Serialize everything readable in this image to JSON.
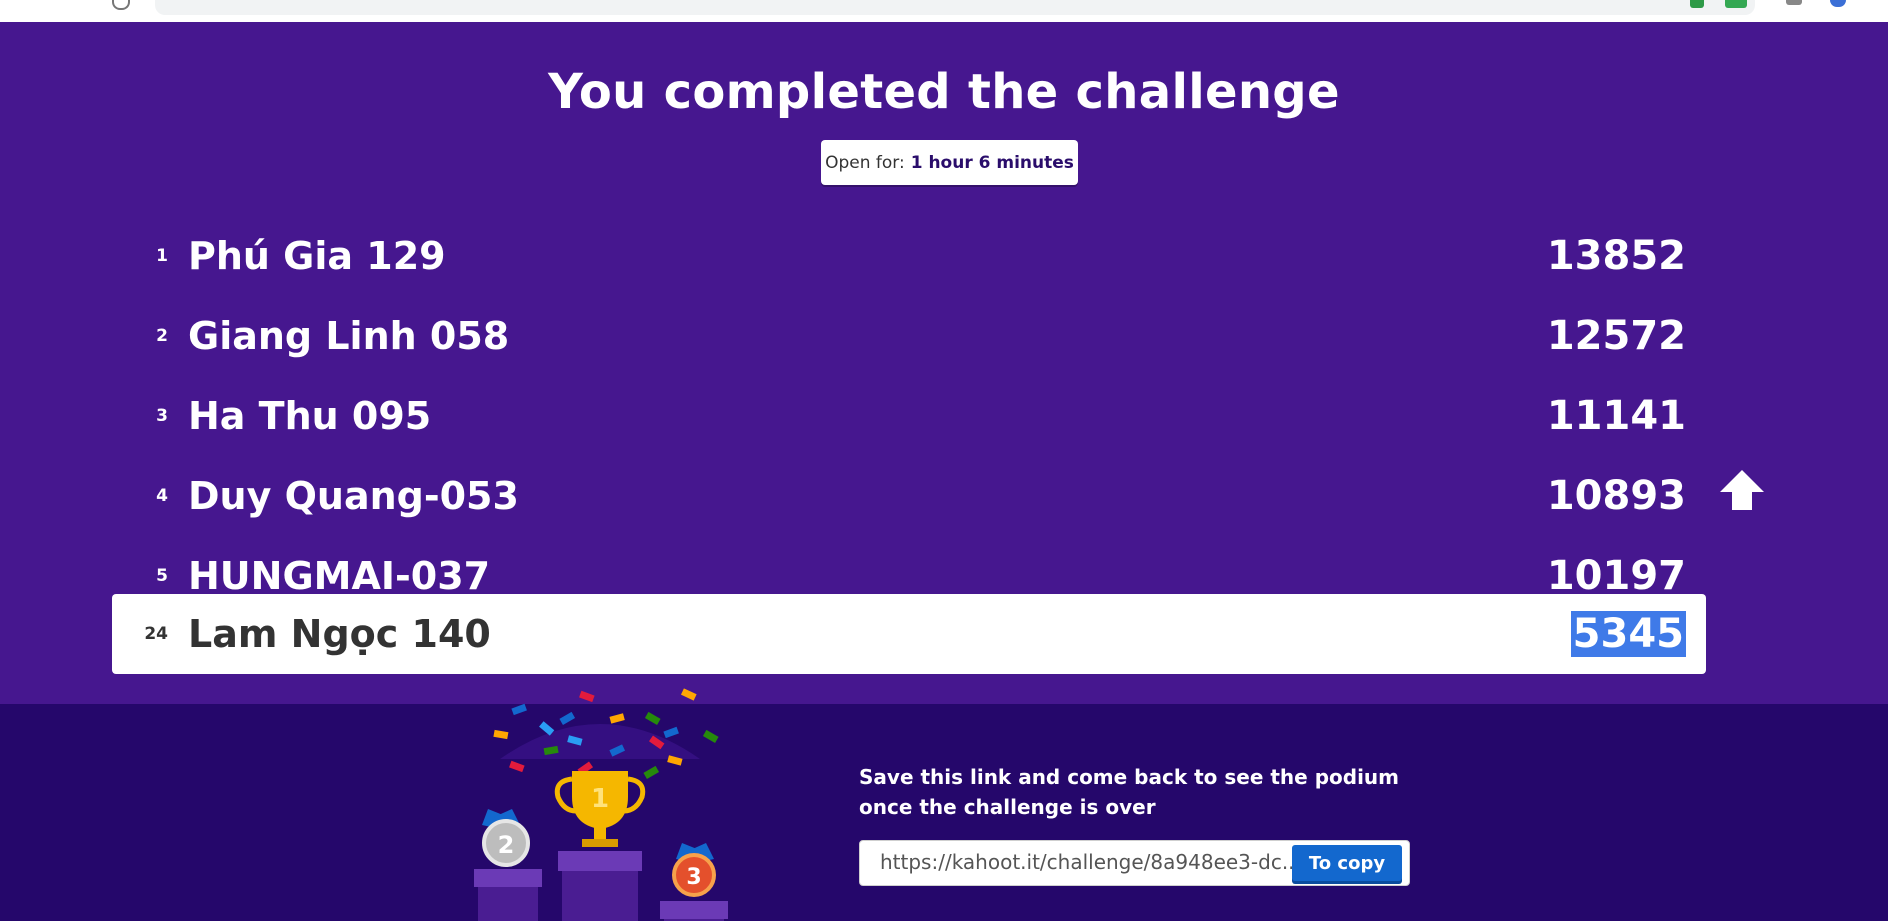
{
  "header": {
    "title": "You completed the challenge",
    "open_for_label": "Open for:",
    "open_for_value": "1 hour 6 minutes"
  },
  "leaderboard": [
    {
      "rank": "1",
      "name": "Phú Gia 129",
      "score": "13852"
    },
    {
      "rank": "2",
      "name": "Giang Linh 058",
      "score": "12572"
    },
    {
      "rank": "3",
      "name": "Ha Thu 095",
      "score": "11141"
    },
    {
      "rank": "4",
      "name": "Duy Quang-053",
      "score": "10893"
    },
    {
      "rank": "5",
      "name": "HUNGMAI-037",
      "score": "10197"
    }
  ],
  "current_player": {
    "rank": "24",
    "name": "Lam Ngọc 140",
    "score": "5345"
  },
  "footer": {
    "save_line1": "Save this link and come back to see the podium",
    "save_line2": "once the challenge is over",
    "link_value": "https://kahoot.it/challenge/8a948ee3-dc...",
    "copy_label": "To copy"
  },
  "podium": {
    "first": "1",
    "second": "2",
    "third": "3"
  },
  "colors": {
    "top_bg": "#46178f",
    "bottom_bg": "#25076b",
    "copy_button": "#1368ce",
    "selection": "#3f7ae8"
  },
  "icons": {
    "scroll_up": "up-arrow-icon",
    "trophy": "trophy-icon"
  }
}
